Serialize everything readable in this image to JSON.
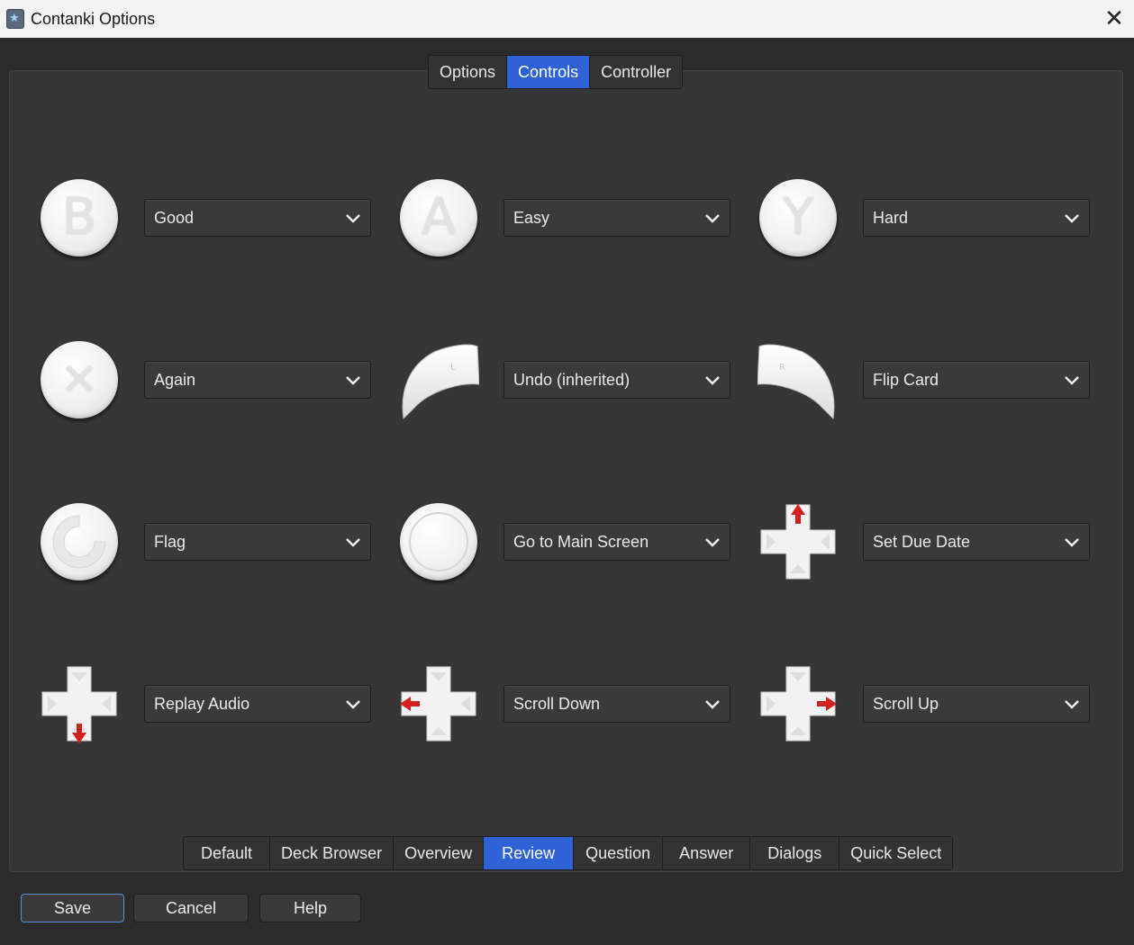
{
  "window": {
    "title": "Contanki Options",
    "close_label": "✕"
  },
  "top_tabs": [
    {
      "label": "Options",
      "active": false
    },
    {
      "label": "Controls",
      "active": true
    },
    {
      "label": "Controller",
      "active": false
    }
  ],
  "controls": [
    {
      "button": "b-button",
      "glyph": "B",
      "action": "Good"
    },
    {
      "button": "a-button",
      "glyph": "A",
      "action": "Easy"
    },
    {
      "button": "y-button",
      "glyph": "Y",
      "action": "Hard"
    },
    {
      "button": "x-button",
      "glyph": "✕",
      "action": "Again"
    },
    {
      "button": "left-bumper",
      "glyph": "L",
      "action": "Undo (inherited)"
    },
    {
      "button": "right-bumper",
      "glyph": "R",
      "action": "Flip Card"
    },
    {
      "button": "share-button",
      "glyph": "",
      "action": "Flag"
    },
    {
      "button": "home-button",
      "glyph": "",
      "action": "Go to Main Screen"
    },
    {
      "button": "dpad-up",
      "glyph": "",
      "action": "Set Due Date"
    },
    {
      "button": "dpad-down",
      "glyph": "",
      "action": "Replay Audio"
    },
    {
      "button": "dpad-left",
      "glyph": "",
      "action": "Scroll Down"
    },
    {
      "button": "dpad-right",
      "glyph": "",
      "action": "Scroll Up"
    }
  ],
  "bottom_tabs": [
    {
      "label": "Default",
      "active": false
    },
    {
      "label": "Deck Browser",
      "active": false
    },
    {
      "label": "Overview",
      "active": false
    },
    {
      "label": "Review",
      "active": true
    },
    {
      "label": "Question",
      "active": false
    },
    {
      "label": "Answer",
      "active": false
    },
    {
      "label": "Dialogs",
      "active": false
    },
    {
      "label": "Quick Select",
      "active": false
    }
  ],
  "buttons": {
    "save": "Save",
    "cancel": "Cancel",
    "help": "Help"
  },
  "colors": {
    "accent": "#2f62d6",
    "arrow": "#d42020"
  }
}
